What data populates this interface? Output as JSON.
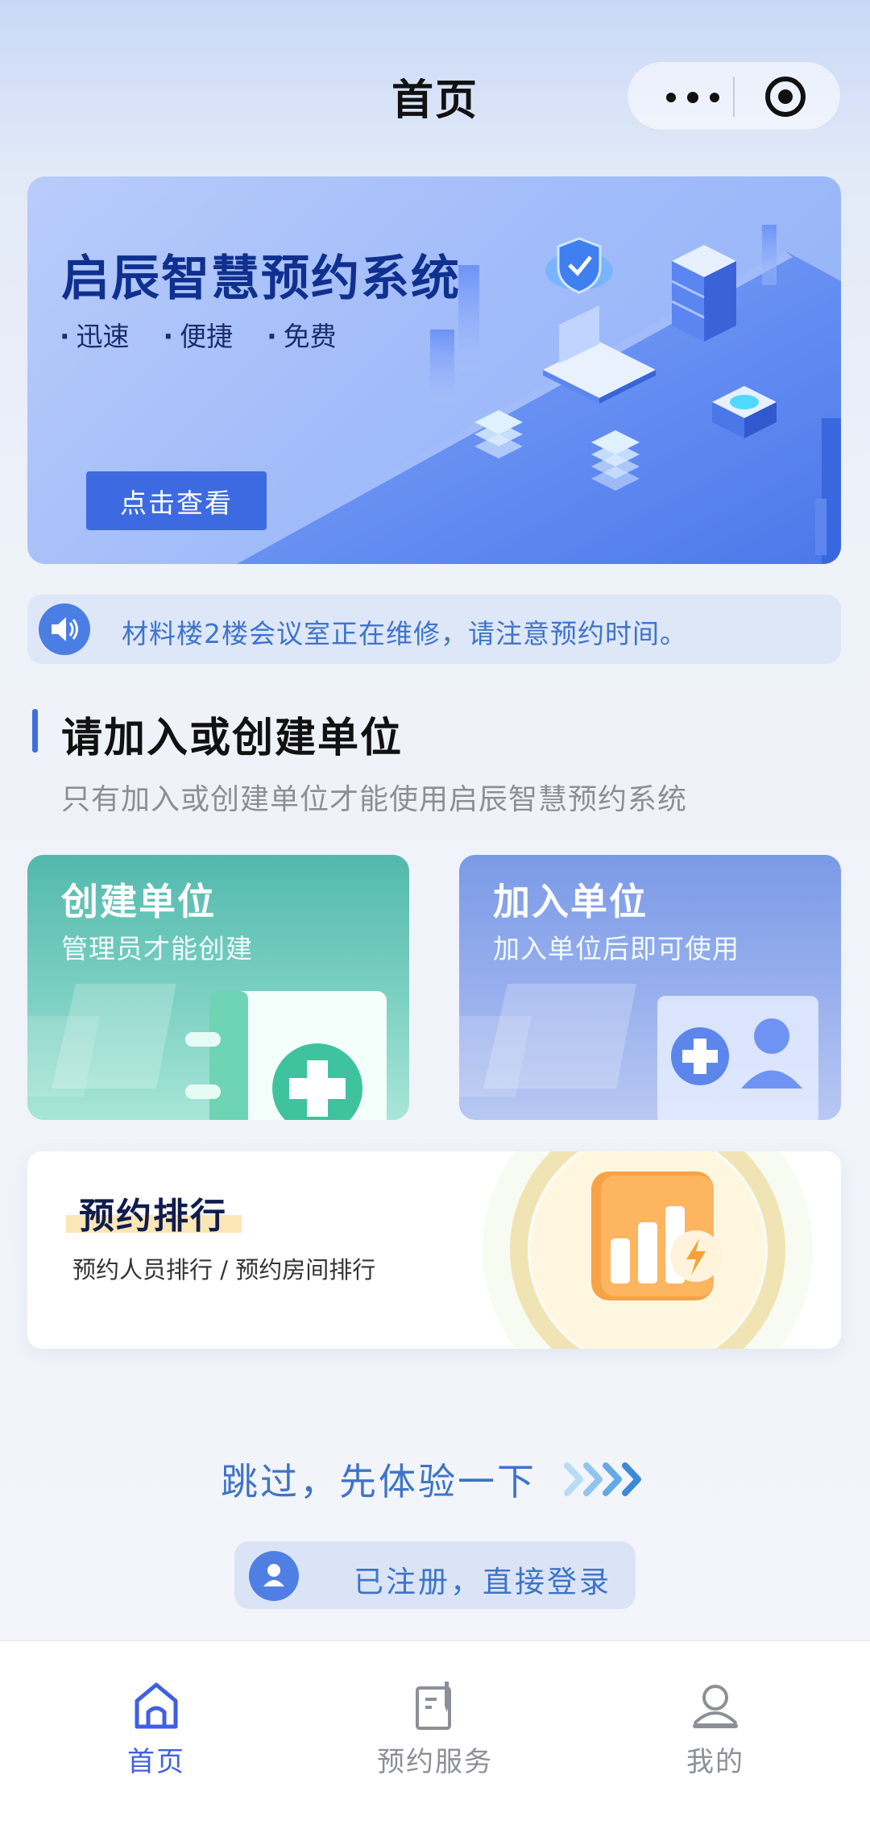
{
  "header": {
    "title": "首页",
    "menu_icon": "more-dots-icon",
    "close_icon": "target-icon"
  },
  "banner": {
    "title": "启辰智慧预约系统",
    "features": [
      "迅速",
      "便捷",
      "免费"
    ],
    "button_label": "点击查看"
  },
  "notice": {
    "icon": "speaker-icon",
    "text": "材料楼2楼会议室正在维修，请注意预约时间。"
  },
  "section": {
    "title": "请加入或创建单位",
    "subtitle": "只有加入或创建单位才能使用启辰智慧预约系统"
  },
  "cards": {
    "create": {
      "title": "创建单位",
      "subtitle": "管理员才能创建"
    },
    "join": {
      "title": "加入单位",
      "subtitle": "加入单位后即可使用"
    }
  },
  "ranking": {
    "title": "预约排行",
    "subtitle": "预约人员排行 / 预约房间排行"
  },
  "skip_label": "跳过，先体验一下",
  "login_label": "已注册，直接登录",
  "tabbar": {
    "items": [
      {
        "label": "首页",
        "icon": "home-icon",
        "active": true
      },
      {
        "label": "预约服务",
        "icon": "document-icon",
        "active": false
      },
      {
        "label": "我的",
        "icon": "user-icon",
        "active": false
      }
    ]
  },
  "colors": {
    "accent": "#3f5fe3",
    "banner_title": "#10308f",
    "notice_text": "#3e74cc",
    "create_card": "#53b9ad",
    "join_card": "#7b9ae6"
  }
}
